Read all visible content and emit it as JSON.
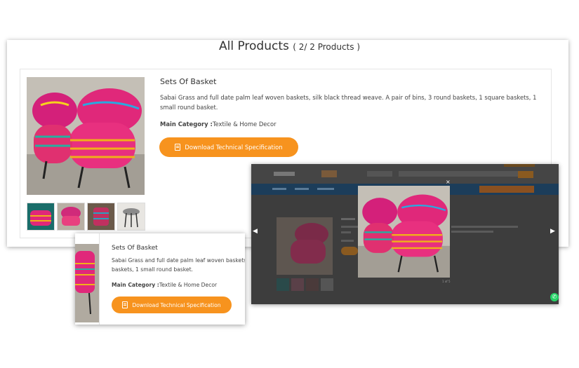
{
  "header": {
    "title": "All Products",
    "count_text": "( 2/ 2 Products )"
  },
  "product": {
    "title": "Sets Of Basket",
    "description": "Sabai Grass and full date palm leaf woven baskets, silk black thread weave. A pair of bins, 3 round baskets, 1 square baskets, 1 small round basket.",
    "category_label": "Main Category :",
    "category_value": "Textile & Home Decor",
    "download_label": "Download Technical Specification",
    "thumb_count": 4
  },
  "zoom": {
    "title": "Sets Of Basket",
    "desc_line1": "Sabai Grass and full date palm leaf woven baskets",
    "desc_line2": "baskets, 1 small round basket.",
    "category_label": "Main Category :",
    "category_value": "Textile & Home Decor",
    "download_label": "Download Technical Specification"
  },
  "lightbox": {
    "close_icon": "×",
    "prev_icon": "◀",
    "next_icon": "▶",
    "counter": "1 of 5"
  },
  "colors": {
    "accent": "#f7931e",
    "lightbox_bg": "#3d3d3d",
    "nav_bar": "#1c3d5a",
    "whatsapp": "#25d366"
  },
  "icons": [
    "document-icon",
    "close-icon",
    "chevron-left-icon",
    "chevron-right-icon",
    "whatsapp-icon"
  ]
}
